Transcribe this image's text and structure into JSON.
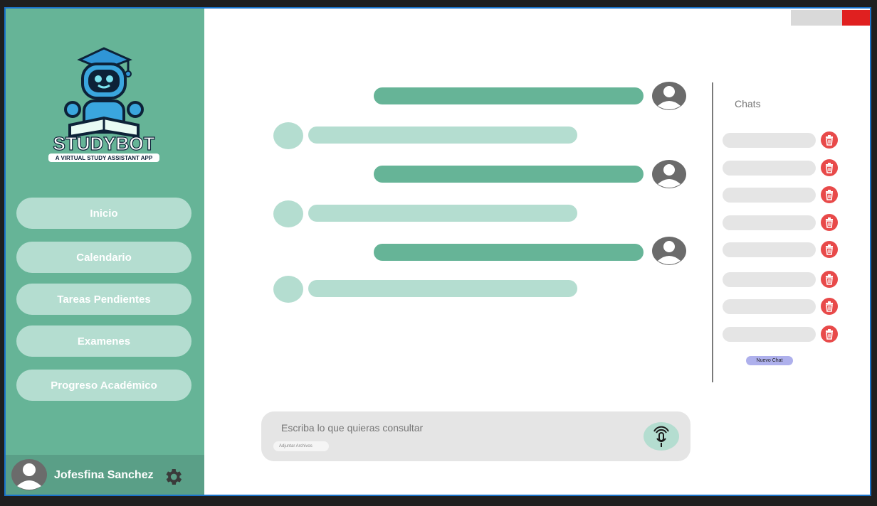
{
  "app": {
    "logo_title": "STUDYBOT",
    "logo_subtitle": "A VIRTUAL STUDY ASSISTANT APP",
    "brand_color": "#66b497",
    "brand_light": "#b4ddd0"
  },
  "sidebar": {
    "items": [
      {
        "label": "Inicio"
      },
      {
        "label": "Calendario"
      },
      {
        "label": "Tareas Pendientes"
      },
      {
        "label": "Examenes"
      },
      {
        "label": "Progreso Académico"
      }
    ]
  },
  "user": {
    "name": "Jofesfina Sanchez",
    "avatar_icon": "user-avatar-icon",
    "settings_icon": "gear-icon"
  },
  "chats_panel": {
    "title": "Chats",
    "item_count": 8,
    "delete_icon": "trash-icon",
    "delete_color": "#e84a4a",
    "new_chat_label": "Nuevo Chat"
  },
  "composer": {
    "placeholder": "Escriba lo que quieras consultar",
    "attach_label": "Adjuntar Archivos",
    "mic_icon": "microphone-icon"
  }
}
